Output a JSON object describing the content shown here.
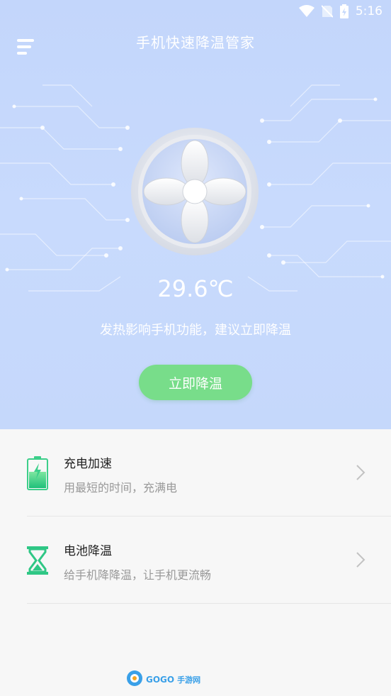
{
  "status_bar": {
    "time": "5:16",
    "icons": [
      "wifi-icon",
      "no-sim-icon",
      "battery-charging-icon"
    ]
  },
  "header": {
    "title": "手机快速降温管家",
    "menu_icon": "menu-icon"
  },
  "hero": {
    "fan_icon": "fan-icon",
    "temperature": "29.6℃",
    "warning": "发热影响手机功能，建议立即降温",
    "cool_button_label": "立即降温",
    "accent_color": "#78dd8a",
    "background_color": "#c5d8fb"
  },
  "features": [
    {
      "icon": "battery-charging-icon",
      "title": "充电加速",
      "description": "用最短的时间，充满电"
    },
    {
      "icon": "hourglass-icon",
      "title": "电池降温",
      "description": "给手机降降温，让手机更流畅"
    }
  ],
  "watermark": {
    "brand": "GOGO",
    "suffix": "手游网"
  }
}
